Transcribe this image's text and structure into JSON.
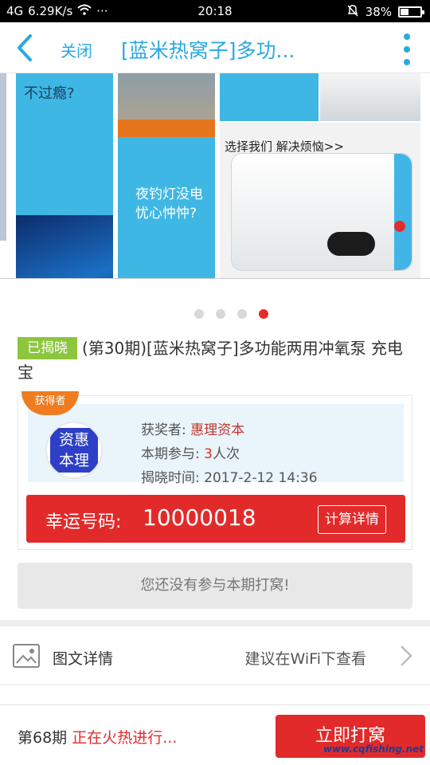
{
  "status_bar": {
    "signal": "4G",
    "speed": "6.29K/s",
    "more": "···",
    "time": "20:18",
    "battery": "38%"
  },
  "nav": {
    "close_label": "关闭",
    "title": "[蓝米热窝子]多功..."
  },
  "banner": {
    "text_top_left": "不过瘾?",
    "text_middle": "夜钓灯没电\n忧心忡忡?",
    "text_right": "选择我们 解决烦恼>>",
    "slide_count": 4,
    "active_slide": 4
  },
  "product": {
    "status_tag": "已揭晓",
    "title": "(第30期)[蓝米热窝子]多功能两用冲氧泵 充电宝"
  },
  "winner": {
    "ribbon": "获得者",
    "avatar_text": "资惠本理",
    "winner_label": "获奖者:",
    "winner_name": "惠理资本",
    "join_label": "本期参与:",
    "join_count": "3",
    "join_unit": "人次",
    "time_label": "揭晓时间:",
    "time_value": "2017-2-12 14:36",
    "lucky_label": "幸运号码:",
    "lucky_number": "10000018",
    "calc_button": "计算详情"
  },
  "notice": "您还没有参与本期打窝!",
  "detail": {
    "label": "图文详情",
    "hint": "建议在WiFi下查看"
  },
  "bottom": {
    "period": "第68期",
    "status": "正在火热进行...",
    "join_button": "立即打窝",
    "watermark": "www.cqfishing.net"
  }
}
